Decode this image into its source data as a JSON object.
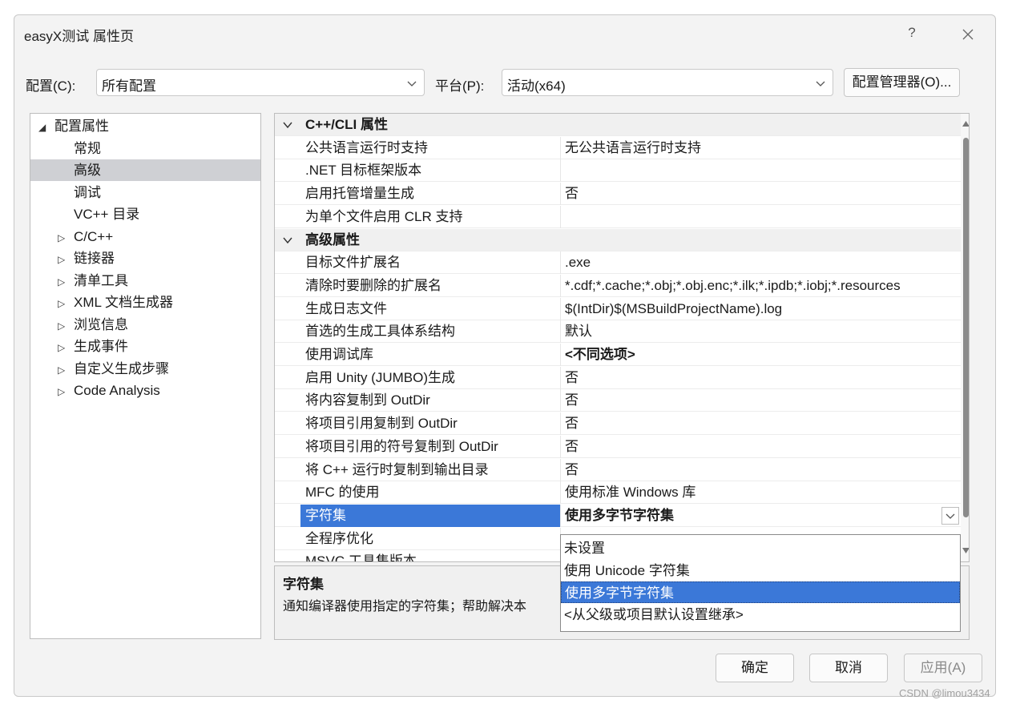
{
  "window": {
    "title": "easyX测试 属性页",
    "help_icon": "?",
    "close_icon": "close-icon"
  },
  "config_bar": {
    "config_label": "配置(C):",
    "config_value": "所有配置",
    "platform_label": "平台(P):",
    "platform_value": "活动(x64)",
    "manager_button": "配置管理器(O)..."
  },
  "tree": {
    "items": [
      {
        "label": "配置属性",
        "toggle": "◢",
        "level": 0,
        "selected": false
      },
      {
        "label": "常规",
        "toggle": "",
        "level": 1,
        "selected": false
      },
      {
        "label": "高级",
        "toggle": "",
        "level": 1,
        "selected": true
      },
      {
        "label": "调试",
        "toggle": "",
        "level": 1,
        "selected": false
      },
      {
        "label": "VC++ 目录",
        "toggle": "",
        "level": 1,
        "selected": false
      },
      {
        "label": "C/C++",
        "toggle": "▷",
        "level": 1,
        "selected": false
      },
      {
        "label": "链接器",
        "toggle": "▷",
        "level": 1,
        "selected": false
      },
      {
        "label": "清单工具",
        "toggle": "▷",
        "level": 1,
        "selected": false
      },
      {
        "label": "XML 文档生成器",
        "toggle": "▷",
        "level": 1,
        "selected": false
      },
      {
        "label": "浏览信息",
        "toggle": "▷",
        "level": 1,
        "selected": false
      },
      {
        "label": "生成事件",
        "toggle": "▷",
        "level": 1,
        "selected": false
      },
      {
        "label": "自定义生成步骤",
        "toggle": "▷",
        "level": 1,
        "selected": false
      },
      {
        "label": "Code Analysis",
        "toggle": "▷",
        "level": 1,
        "selected": false
      }
    ]
  },
  "grid": {
    "rows": [
      {
        "type": "category",
        "name": "C++/CLI 属性"
      },
      {
        "type": "prop",
        "name": "公共语言运行时支持",
        "value": "无公共语言运行时支持"
      },
      {
        "type": "prop",
        "name": ".NET 目标框架版本",
        "value": ""
      },
      {
        "type": "prop",
        "name": "启用托管增量生成",
        "value": "否"
      },
      {
        "type": "prop",
        "name": "为单个文件启用 CLR 支持",
        "value": ""
      },
      {
        "type": "category",
        "name": "高级属性"
      },
      {
        "type": "prop",
        "name": "目标文件扩展名",
        "value": ".exe"
      },
      {
        "type": "prop",
        "name": "清除时要删除的扩展名",
        "value": "*.cdf;*.cache;*.obj;*.obj.enc;*.ilk;*.ipdb;*.iobj;*.resources"
      },
      {
        "type": "prop",
        "name": "生成日志文件",
        "value": "$(IntDir)$(MSBuildProjectName).log"
      },
      {
        "type": "prop",
        "name": "首选的生成工具体系结构",
        "value": "默认"
      },
      {
        "type": "prop",
        "name": "使用调试库",
        "value": "<不同选项>",
        "bold": true
      },
      {
        "type": "prop",
        "name": "启用 Unity (JUMBO)生成",
        "value": "否"
      },
      {
        "type": "prop",
        "name": "将内容复制到 OutDir",
        "value": "否"
      },
      {
        "type": "prop",
        "name": "将项目引用复制到 OutDir",
        "value": "否"
      },
      {
        "type": "prop",
        "name": "将项目引用的符号复制到 OutDir",
        "value": "否"
      },
      {
        "type": "prop",
        "name": "将 C++ 运行时复制到输出目录",
        "value": "否"
      },
      {
        "type": "prop",
        "name": "MFC 的使用",
        "value": "使用标准 Windows 库"
      },
      {
        "type": "prop",
        "name": "字符集",
        "value": "使用多字节字符集",
        "bold": true,
        "selected": true
      },
      {
        "type": "prop",
        "name": "全程序优化",
        "value": ""
      },
      {
        "type": "prop",
        "name": "MSVC 工具集版本",
        "value": ""
      }
    ]
  },
  "description": {
    "title": "字符集",
    "text": "通知编译器使用指定的字符集；帮助解决本"
  },
  "dropdown": {
    "options": [
      "未设置",
      "使用 Unicode 字符集",
      "使用多字节字符集",
      "<从父级或项目默认设置继承>"
    ],
    "selected_index": 2
  },
  "footer": {
    "ok": "确定",
    "cancel": "取消",
    "apply": "应用(A)"
  },
  "watermark": "CSDN @limou3434",
  "colors": {
    "selection": "#3b78d8",
    "tree_selection": "#cfd0d4",
    "dialog_bg": "#f3f3f3"
  }
}
